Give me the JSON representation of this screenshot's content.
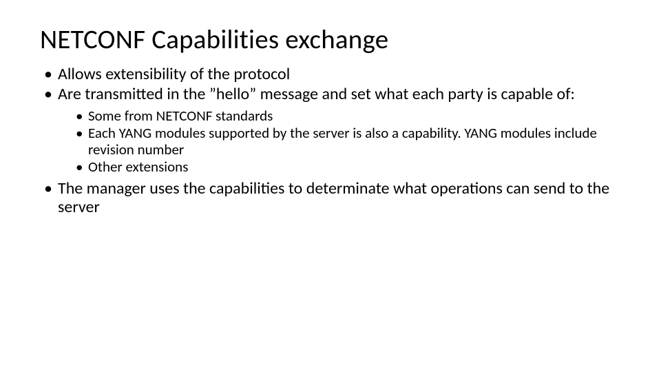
{
  "title": "NETCONF Capabilities exchange",
  "bullets": {
    "b0": "Allows extensibility of the protocol",
    "b1": "Are transmitted in the ”hello” message and set what each party is capable of:",
    "b1_sub": {
      "s0": "Some from NETCONF standards",
      "s1": "Each YANG modules supported by the server is also a capability. YANG modules include revision number",
      "s2": "Other extensions"
    },
    "b2": "The manager uses the capabilities to determinate what operations can send to the server"
  }
}
